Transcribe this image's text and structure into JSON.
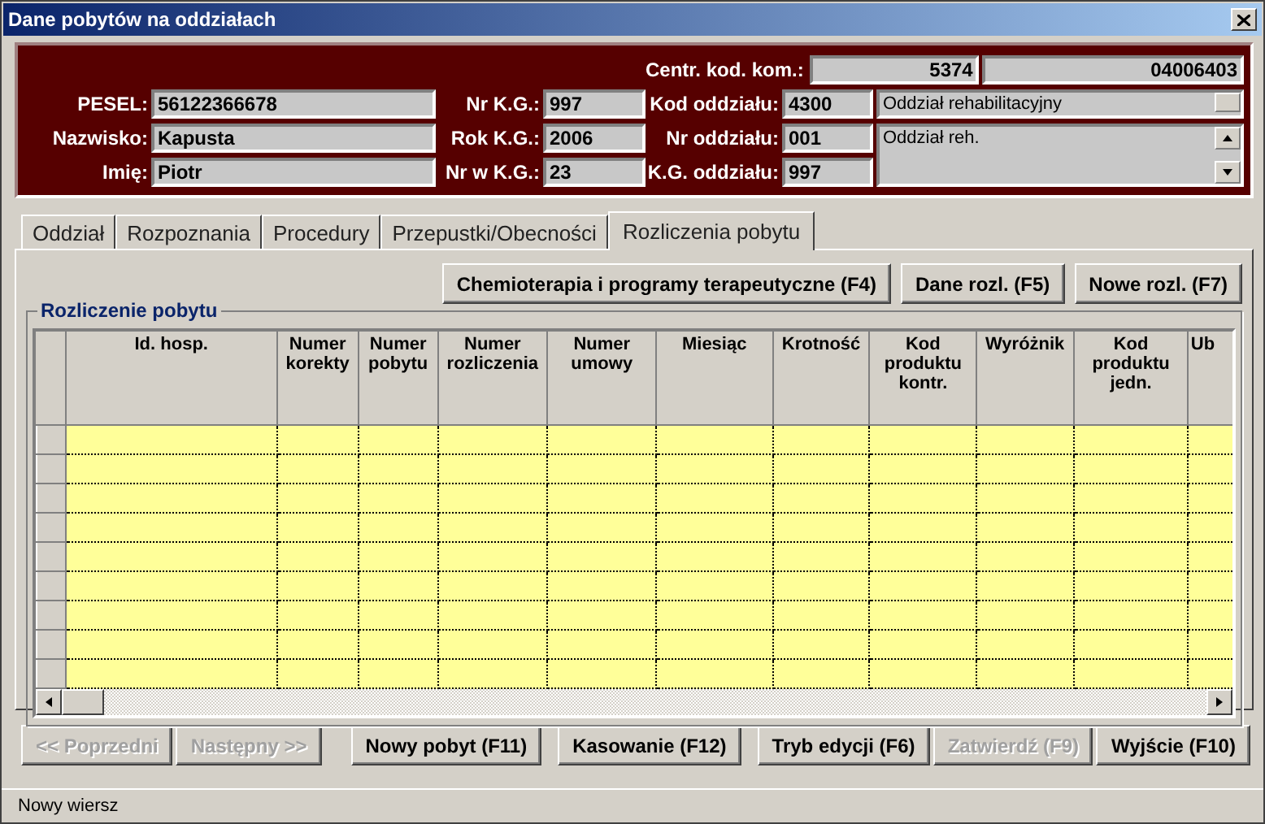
{
  "window": {
    "title": "Dane pobytów na oddziałach"
  },
  "header": {
    "centr_kod_kom": {
      "label": "Centr. kod. kom.:",
      "values": [
        "5374",
        "04006403"
      ]
    },
    "patient": [
      {
        "label": "PESEL:",
        "value": "56122366678"
      },
      {
        "label": "Nazwisko:",
        "value": "Kapusta"
      },
      {
        "label": "Imię:",
        "value": "Piotr"
      }
    ],
    "kg": [
      {
        "label": "Nr K.G.:",
        "value": "997"
      },
      {
        "label": "Rok K.G.:",
        "value": "2006"
      },
      {
        "label": "Nr w K.G.:",
        "value": "23"
      }
    ],
    "oddzial": [
      {
        "label": "Kod oddziału:",
        "value": "4300"
      },
      {
        "label": "Nr oddziału:",
        "value": "001"
      },
      {
        "label": "K.G. oddziału:",
        "value": "997"
      }
    ],
    "oddzial_name": "Oddział rehabilitacyjny",
    "oddzial_note": "Oddział reh."
  },
  "tabs": [
    {
      "label": "Oddział",
      "selected": false
    },
    {
      "label": "Rozpoznania",
      "selected": false
    },
    {
      "label": "Procedury",
      "selected": false
    },
    {
      "label": "Przepustki/Obecności",
      "selected": false
    },
    {
      "label": "Rozliczenia pobytu",
      "selected": true
    }
  ],
  "tab_buttons": [
    "Chemioterapia i programy terapeutyczne (F4)",
    "Dane rozl. (F5)",
    "Nowe rozl. (F7)"
  ],
  "group": {
    "title": "Rozliczenie pobytu",
    "columns": [
      "Id. hosp.",
      "Numer korekty",
      "Numer pobytu",
      "Numer rozliczenia",
      "Numer umowy",
      "Miesiąc",
      "Krotność",
      "Kod produktu kontr.",
      "Wyróżnik",
      "Kod produktu jedn.",
      "Ub"
    ]
  },
  "buttons": [
    {
      "label": "<< Poprzedni",
      "disabled": true
    },
    {
      "label": "Następny >>",
      "disabled": true
    },
    {
      "label": "Nowy pobyt (F11)",
      "disabled": false
    },
    {
      "label": "Kasowanie (F12)",
      "disabled": false
    },
    {
      "label": "Tryb edycji (F6)",
      "disabled": false
    },
    {
      "label": "Zatwierdź (F9)",
      "disabled": true
    },
    {
      "label": "Wyjście (F10)",
      "disabled": false
    }
  ],
  "status_bar": "Nowy wiersz"
}
